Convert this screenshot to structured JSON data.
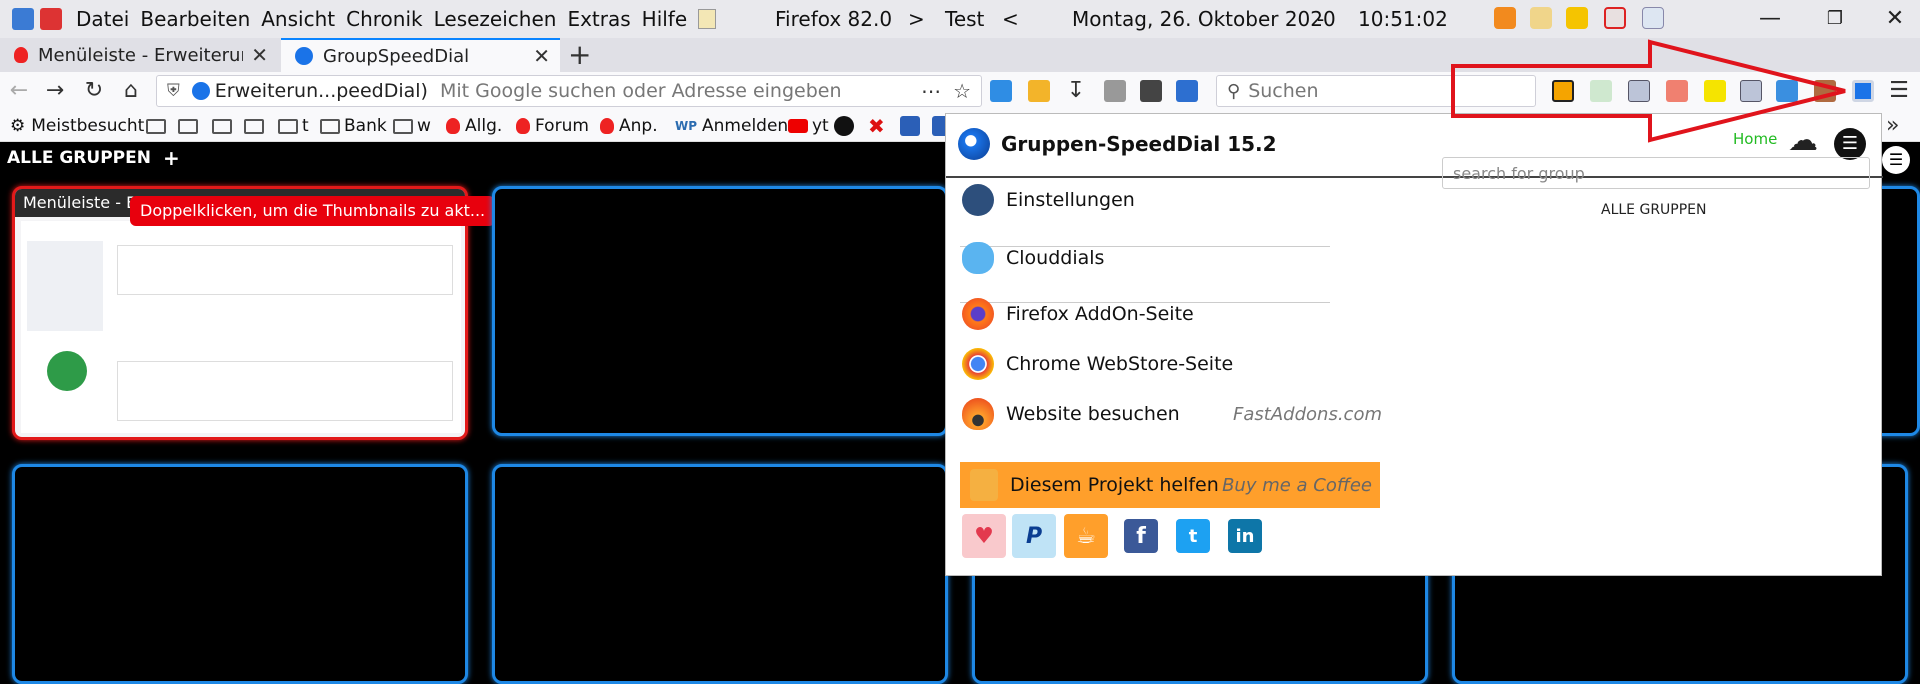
{
  "menubar": {
    "items": [
      "Datei",
      "Bearbeiten",
      "Ansicht",
      "Chronik",
      "Lesezeichen",
      "Extras",
      "Hilfe"
    ],
    "browser": "Firefox 82.0",
    "sep1": ">",
    "profile": "Test",
    "sep2": "<",
    "date": "Montag, 26. Oktober 2020",
    "dash": "-",
    "time": "10:51:02"
  },
  "tabs": [
    {
      "label": "Menüleiste - Erweiterungen"
    },
    {
      "label": "GroupSpeedDial"
    }
  ],
  "urlbar": {
    "current": "Erweiterun...peedDial)",
    "placeholder": "Mit Google suchen oder Adresse eingeben"
  },
  "searchbar": {
    "placeholder": "Suchen"
  },
  "bookmarks": [
    {
      "label": "Meistbesucht"
    },
    {
      "label": "t"
    },
    {
      "label": "Bank"
    },
    {
      "label": "w"
    },
    {
      "label": "Allg."
    },
    {
      "label": "Forum"
    },
    {
      "label": "Anp."
    },
    {
      "label": "Anmelden"
    },
    {
      "label": "yt"
    }
  ],
  "page": {
    "groups_label": "ALLE GRUPPEN",
    "add_label": "+",
    "tile_title": "Menüleiste - Er",
    "tooltip": "Doppelklicken, um die Thumbnails zu akt..."
  },
  "popup": {
    "title": "Gruppen-SpeedDial 15.2",
    "home": "Home",
    "search_placeholder": "search for group",
    "group_list_item": "ALLE GRUPPEN",
    "items": {
      "settings": "Einstellungen",
      "clouddials": "Clouddials",
      "addon_page": "Firefox AddOn-Seite",
      "webstore": "Chrome WebStore-Seite",
      "website": "Website besuchen",
      "website_domain": "FastAddons.com",
      "help": "Diesem Projekt helfen",
      "coffee": "Buy me a Coffee"
    }
  },
  "colors": {
    "accent": "#0a84ff",
    "tile_border": "#1e88e5",
    "tooltip_bg": "#e8000d",
    "help_bg": "#ff9f2b",
    "home_green": "#22bb22",
    "arrow": "#e0141c"
  }
}
